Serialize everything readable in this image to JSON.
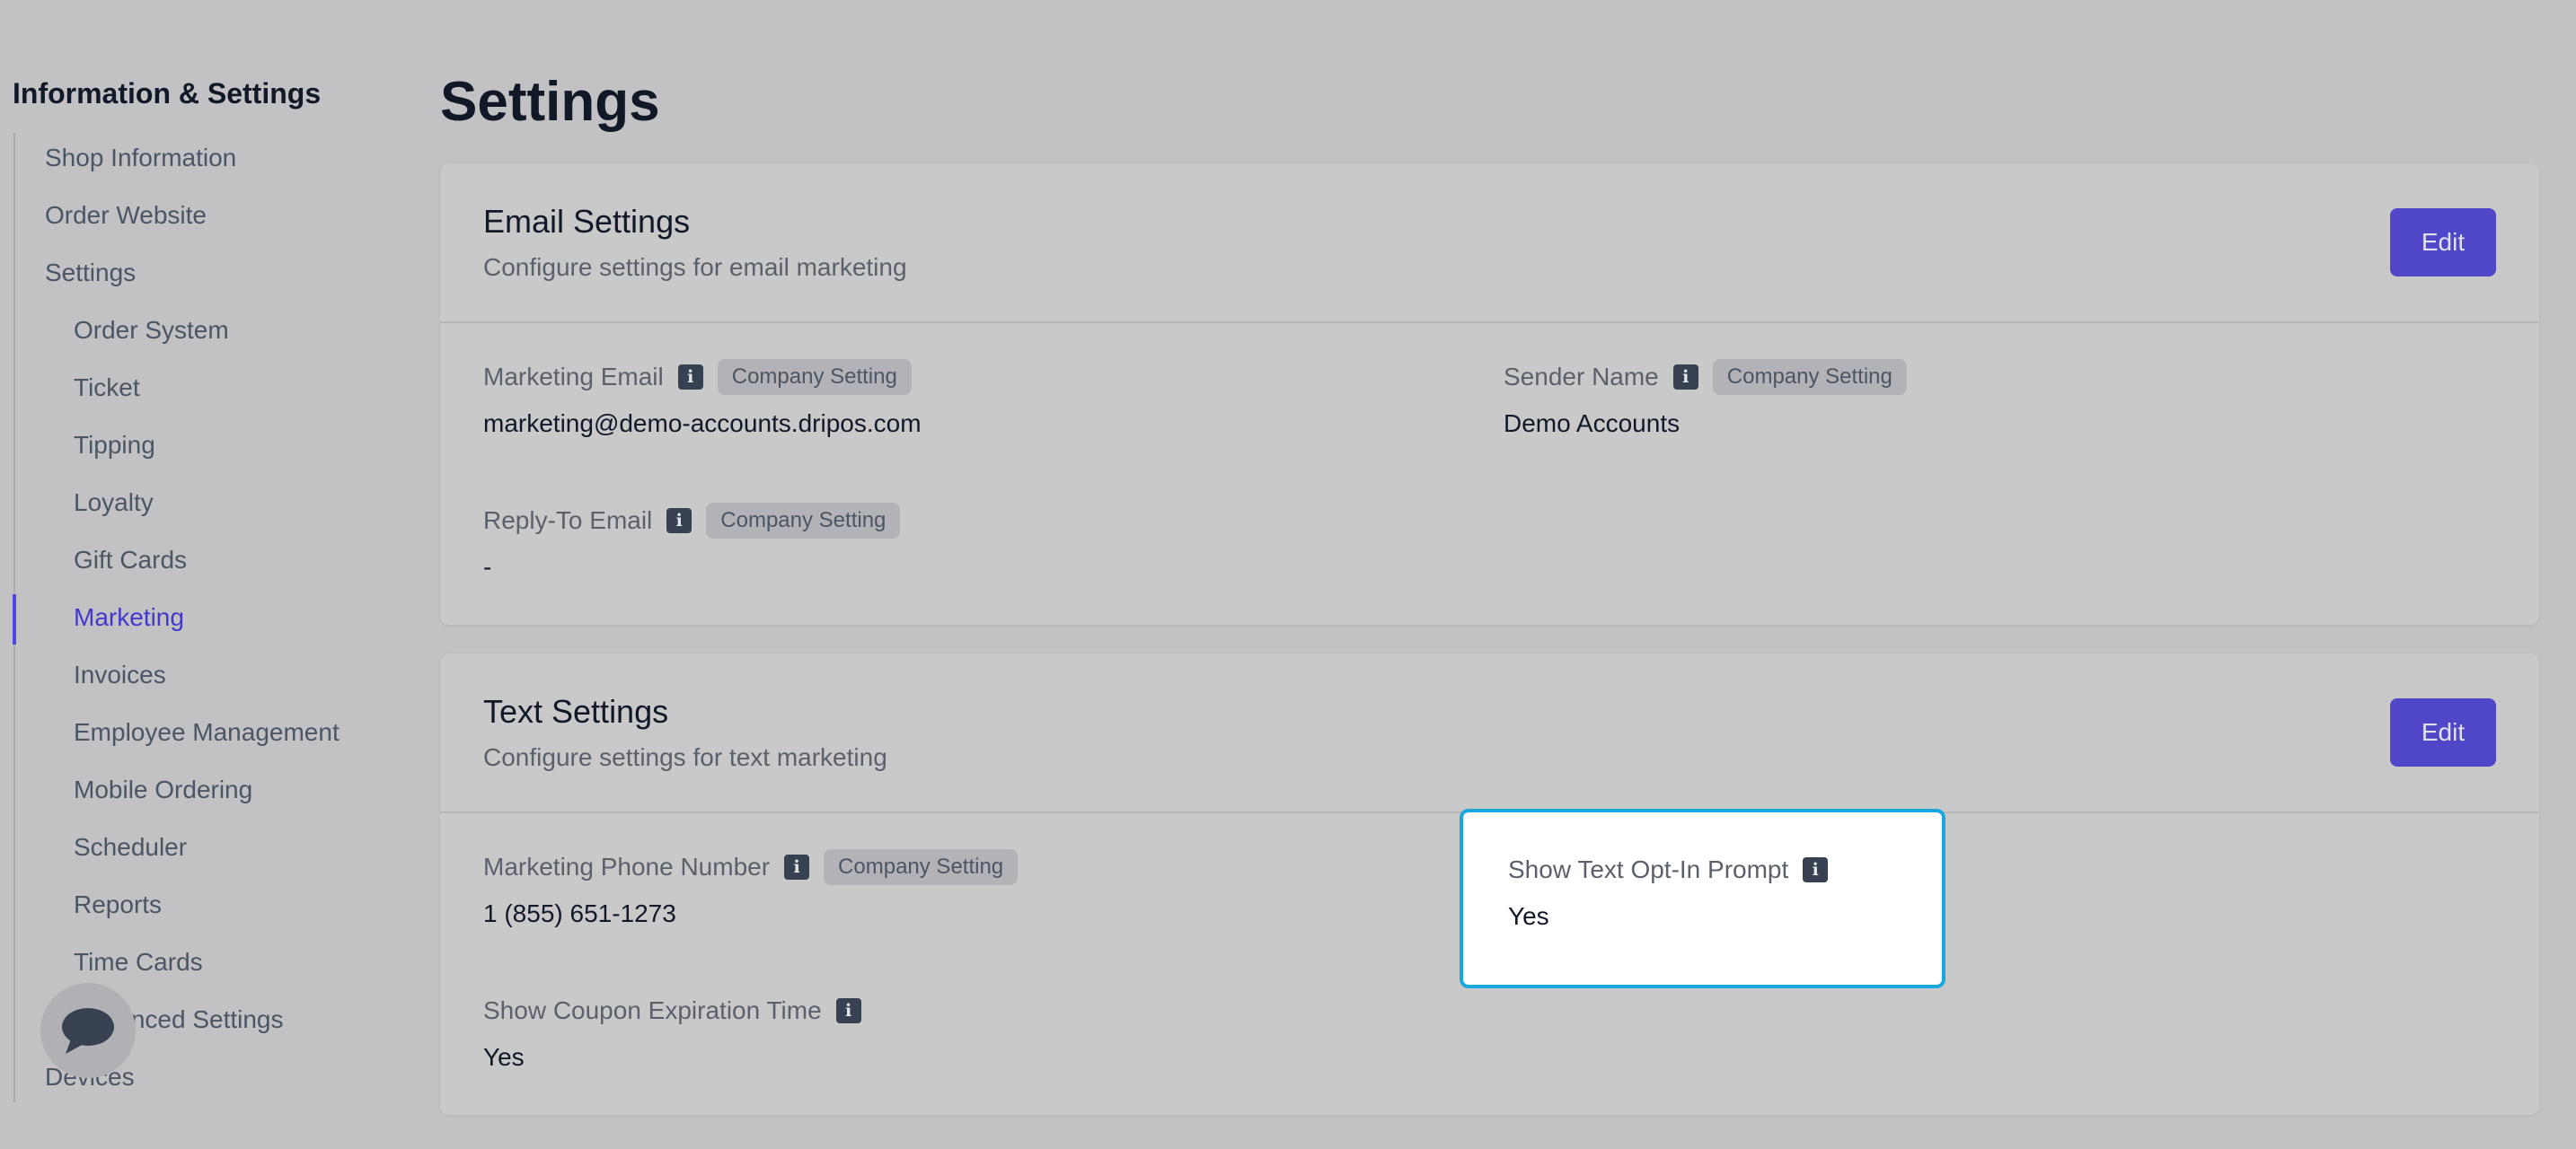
{
  "sidebar": {
    "title": "Information & Settings",
    "items": [
      {
        "label": "Shop Information"
      },
      {
        "label": "Order Website"
      },
      {
        "label": "Settings"
      },
      {
        "label": "Order System"
      },
      {
        "label": "Ticket"
      },
      {
        "label": "Tipping"
      },
      {
        "label": "Loyalty"
      },
      {
        "label": "Gift Cards"
      },
      {
        "label": "Marketing"
      },
      {
        "label": "Invoices"
      },
      {
        "label": "Employee Management"
      },
      {
        "label": "Mobile Ordering"
      },
      {
        "label": "Scheduler"
      },
      {
        "label": "Reports"
      },
      {
        "label": "Time Cards"
      },
      {
        "label": "Advanced Settings"
      },
      {
        "label": "Devices"
      }
    ],
    "active_item": "Marketing",
    "active_color": "#4338ca"
  },
  "page": {
    "title": "Settings"
  },
  "email_settings": {
    "title": "Email Settings",
    "subtitle": "Configure settings for email marketing",
    "edit_label": "Edit",
    "fields": {
      "marketing_email": {
        "label": "Marketing Email",
        "badge": "Company Setting",
        "value": "marketing@demo-accounts.dripos.com"
      },
      "sender_name": {
        "label": "Sender Name",
        "badge": "Company Setting",
        "value": "Demo Accounts"
      },
      "reply_to_email": {
        "label": "Reply-To Email",
        "badge": "Company Setting",
        "value": "-"
      }
    }
  },
  "text_settings": {
    "title": "Text Settings",
    "subtitle": "Configure settings for text marketing",
    "edit_label": "Edit",
    "fields": {
      "marketing_phone": {
        "label": "Marketing Phone Number",
        "badge": "Company Setting",
        "value": "1 (855) 651-1273"
      },
      "opt_in_prompt": {
        "label": "Show Text Opt-In Prompt",
        "value": "Yes"
      },
      "coupon_expiration": {
        "label": "Show Coupon Expiration Time",
        "value": "Yes"
      }
    }
  },
  "icons": {
    "info": "info-icon",
    "chat": "chat-bubble-icon",
    "info_glyph": "i"
  },
  "colors": {
    "accent": "#4f46c8",
    "highlight_border": "#1aa7e0",
    "background": "#c2c2c5"
  }
}
